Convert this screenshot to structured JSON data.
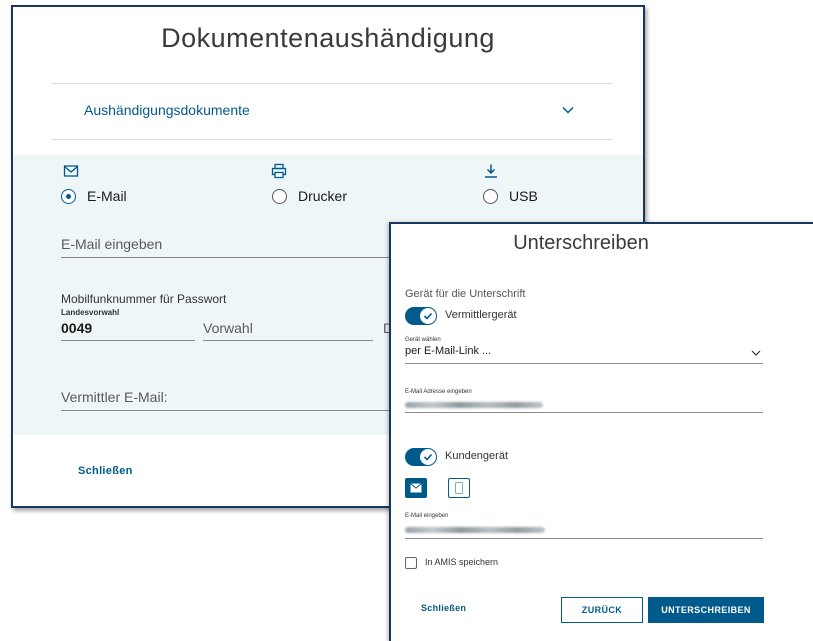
{
  "documents_dialog": {
    "title": "Dokumentenaushändigung",
    "accordion_label": "Aushändigungsdokumente",
    "options": [
      {
        "label": "E-Mail",
        "icon": "mail-icon",
        "selected": true
      },
      {
        "label": "Drucker",
        "icon": "printer-icon",
        "selected": false
      },
      {
        "label": "USB",
        "icon": "download-icon",
        "selected": false
      }
    ],
    "email_placeholder": "E-Mail eingeben",
    "mobile_label": "Mobilfunknummer für Passwort",
    "country_code_label": "Landesvorwahl",
    "country_code_value": "0049",
    "area_code_placeholder": "Vorwahl",
    "number_placeholder_fragment": "D",
    "agent_email_placeholder": "Vermittler E-Mail:",
    "close_label": "Schließen"
  },
  "sign_dialog": {
    "title": "Unterschreiben",
    "device_section_label": "Gerät für die Unterschrift",
    "agent_device_toggle_label": "Vermittlergerät",
    "agent_device_toggle_on": true,
    "select_device_label": "Gerät wählen",
    "select_device_value": "per E-Mail-Link ...",
    "email_address_label": "E-Mail Adresse eingeben",
    "customer_device_toggle_label": "Kundengerät",
    "customer_device_toggle_on": true,
    "channel_buttons": [
      {
        "icon": "mail-icon",
        "active": true
      },
      {
        "icon": "mobile-icon",
        "active": false
      }
    ],
    "customer_email_label": "E-Mail eingeben",
    "save_amis_label": "In AMIS speichern",
    "save_amis_checked": false,
    "close_label": "Schließen",
    "back_label": "ZURÜCK",
    "sign_label": "UNTERSCHREIBEN"
  },
  "colors": {
    "accent": "#005a8c",
    "dialog_border": "#17375e",
    "band_background": "#eef6f8"
  }
}
